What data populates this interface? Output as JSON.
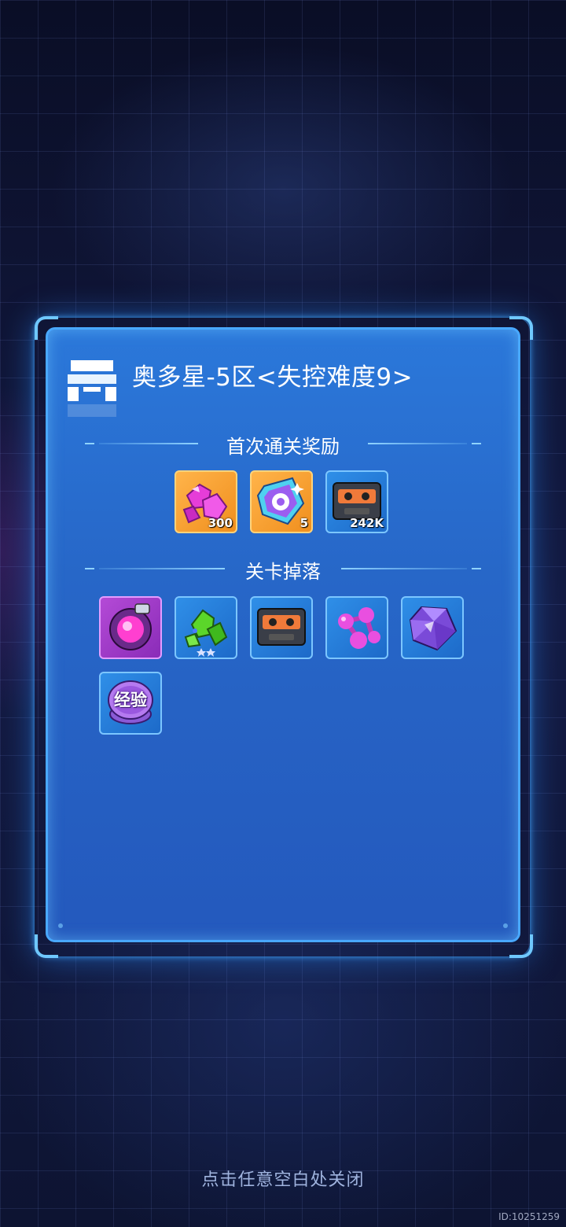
{
  "dialog": {
    "title": "奥多星-5区<失控难度9>",
    "first_clear_label": "首次通关奖励",
    "drops_label": "关卡掉落"
  },
  "first_clear_rewards": [
    {
      "icon": "magenta-crystal-icon",
      "quantity": "300",
      "frame": "orange"
    },
    {
      "icon": "blue-gem-chip-icon",
      "quantity": "5",
      "frame": "orange"
    },
    {
      "icon": "cassette-tape-icon",
      "quantity": "242K",
      "frame": "blue"
    }
  ],
  "stage_drops": [
    {
      "icon": "pink-energy-core-icon",
      "frame": "purple"
    },
    {
      "icon": "green-ore-icon",
      "frame": "blue",
      "stars": 2
    },
    {
      "icon": "cassette-tape-icon",
      "frame": "blue"
    },
    {
      "icon": "molecule-icon",
      "frame": "blue"
    },
    {
      "icon": "purple-diamond-icon",
      "frame": "blue"
    },
    {
      "icon": "exp-coin-icon",
      "label": "经验",
      "frame": "blue"
    }
  ],
  "footer": {
    "close_hint": "点击任意空白处关闭",
    "build_id": "ID:10251259"
  },
  "colors": {
    "panel": "#2767c8",
    "panel_border": "#49a8ff",
    "glow": "#6fc8ff"
  }
}
